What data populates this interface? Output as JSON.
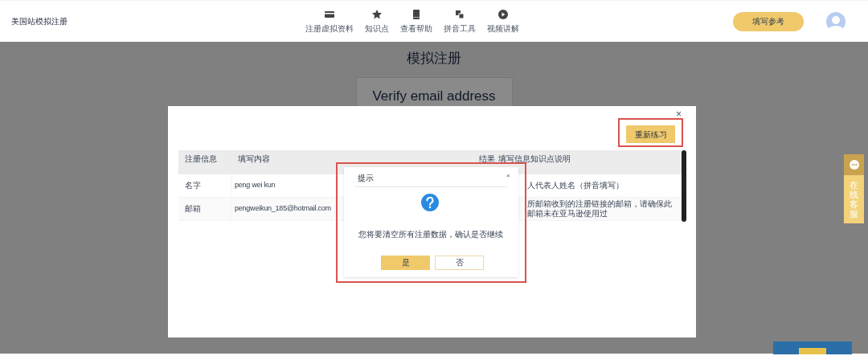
{
  "header": {
    "title": "美国站模拟注册",
    "nav": [
      {
        "label": "注册虚拟资料"
      },
      {
        "label": "知识点"
      },
      {
        "label": "查看帮助"
      },
      {
        "label": "拼音工具"
      },
      {
        "label": "视频讲解"
      }
    ],
    "reference_button": "填写参考"
  },
  "page": {
    "heading": "模拟注册",
    "step_title": "Verify email address"
  },
  "modal": {
    "close": "×",
    "retry_button": "重新练习",
    "table": {
      "columns": [
        "注册信息",
        "填写内容",
        "结果",
        "填写信息知识点说明"
      ],
      "rows": [
        {
          "field": "名字",
          "value": "peng wei kun",
          "note": "人代表人姓名（拼音填写）"
        },
        {
          "field": "邮箱",
          "value": "pengweikun_185@hotmail.com",
          "note": "所邮箱收到的注册链接的邮箱，请确保此邮箱未在亚马逊使用过"
        }
      ]
    }
  },
  "dialog": {
    "title": "提示",
    "close": "×",
    "message": "您将要清空所有注册数据，确认是否继续",
    "buttons": [
      {
        "label": "是",
        "kind": "primary"
      },
      {
        "label": "否",
        "kind": "secondary"
      }
    ]
  },
  "chat_widget": {
    "label": "在线客服"
  }
}
